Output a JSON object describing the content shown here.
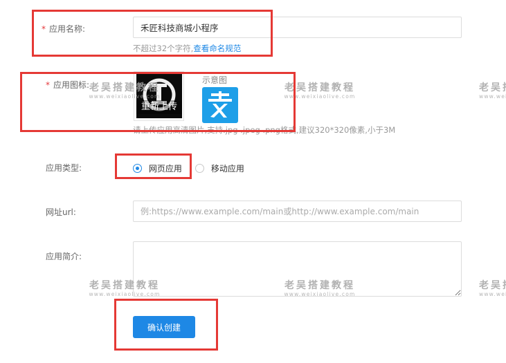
{
  "form": {
    "app_name": {
      "label": "应用名称:",
      "value": "禾匠科技商城小程序",
      "hint": "不超过32个字符,",
      "hint_link": "查看命名规范"
    },
    "app_icon": {
      "label": "应用图标:",
      "upload_label": "重新上传",
      "sample_label": "示意图",
      "hint": "请上传应用高清图片,支持.jpg .jpeg .png格式,建议320*320像素,小于3M"
    },
    "app_type": {
      "label": "应用类型:",
      "options": [
        {
          "label": "网页应用",
          "selected": true
        },
        {
          "label": "移动应用",
          "selected": false
        }
      ]
    },
    "url": {
      "label": "网址url:",
      "placeholder": "例:https://www.example.com/main或http://www.example.com/main"
    },
    "intro": {
      "label": "应用简介:"
    },
    "submit_label": "确认创建"
  },
  "watermark": {
    "title": "老吴搭建教程",
    "url": "www.weixiaolive.com"
  },
  "colors": {
    "accent": "#1e88e5",
    "required": "#e4393c",
    "highlight": "#e53935"
  }
}
